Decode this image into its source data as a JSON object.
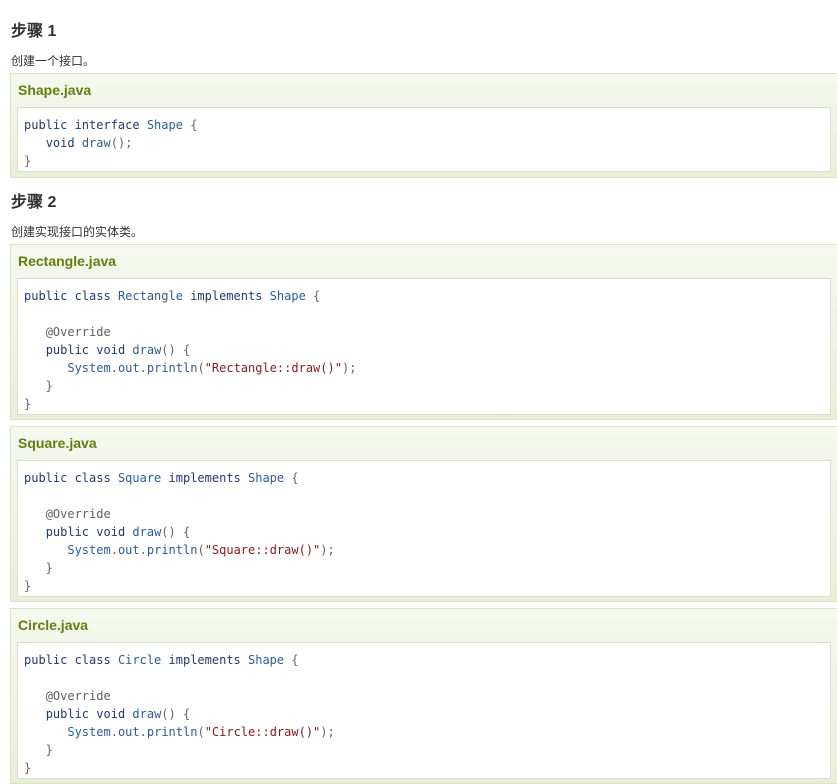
{
  "steps": [
    {
      "title": "步骤 1",
      "desc": "创建一个接口。",
      "examples": [
        {
          "filename": "Shape.java",
          "lines": [
            [
              {
                "t": "kw",
                "v": "public "
              },
              {
                "t": "kw",
                "v": "interface "
              },
              {
                "t": "tp",
                "v": "Shape "
              },
              {
                "t": "pn",
                "v": "{"
              }
            ],
            [
              {
                "t": "pn",
                "v": "   "
              },
              {
                "t": "kw",
                "v": "void "
              },
              {
                "t": "fn",
                "v": "draw"
              },
              {
                "t": "pn",
                "v": "();"
              }
            ],
            [
              {
                "t": "pn",
                "v": "}"
              }
            ]
          ]
        }
      ]
    },
    {
      "title": "步骤 2",
      "desc": "创建实现接口的实体类。",
      "examples": [
        {
          "filename": "Rectangle.java",
          "lines": [
            [
              {
                "t": "kw",
                "v": "public "
              },
              {
                "t": "kw",
                "v": "class "
              },
              {
                "t": "tp",
                "v": "Rectangle "
              },
              {
                "t": "kw",
                "v": "implements "
              },
              {
                "t": "tp",
                "v": "Shape "
              },
              {
                "t": "pn",
                "v": "{"
              }
            ],
            [],
            [
              {
                "t": "pn",
                "v": "   "
              },
              {
                "t": "an",
                "v": "@Override"
              }
            ],
            [
              {
                "t": "pn",
                "v": "   "
              },
              {
                "t": "kw",
                "v": "public "
              },
              {
                "t": "kw",
                "v": "void "
              },
              {
                "t": "fn",
                "v": "draw"
              },
              {
                "t": "pn",
                "v": "() {"
              }
            ],
            [
              {
                "t": "pn",
                "v": "      "
              },
              {
                "t": "fn",
                "v": "System"
              },
              {
                "t": "pn",
                "v": "."
              },
              {
                "t": "fn",
                "v": "out"
              },
              {
                "t": "pn",
                "v": "."
              },
              {
                "t": "fn",
                "v": "println"
              },
              {
                "t": "pn",
                "v": "("
              },
              {
                "t": "st",
                "v": "\"Rectangle::draw()\""
              },
              {
                "t": "pn",
                "v": ");"
              }
            ],
            [
              {
                "t": "pn",
                "v": "   }"
              }
            ],
            [
              {
                "t": "pn",
                "v": "}"
              }
            ]
          ]
        },
        {
          "filename": "Square.java",
          "lines": [
            [
              {
                "t": "kw",
                "v": "public "
              },
              {
                "t": "kw",
                "v": "class "
              },
              {
                "t": "tp",
                "v": "Square "
              },
              {
                "t": "kw",
                "v": "implements "
              },
              {
                "t": "tp",
                "v": "Shape "
              },
              {
                "t": "pn",
                "v": "{"
              }
            ],
            [],
            [
              {
                "t": "pn",
                "v": "   "
              },
              {
                "t": "an",
                "v": "@Override"
              }
            ],
            [
              {
                "t": "pn",
                "v": "   "
              },
              {
                "t": "kw",
                "v": "public "
              },
              {
                "t": "kw",
                "v": "void "
              },
              {
                "t": "fn",
                "v": "draw"
              },
              {
                "t": "pn",
                "v": "() {"
              }
            ],
            [
              {
                "t": "pn",
                "v": "      "
              },
              {
                "t": "fn",
                "v": "System"
              },
              {
                "t": "pn",
                "v": "."
              },
              {
                "t": "fn",
                "v": "out"
              },
              {
                "t": "pn",
                "v": "."
              },
              {
                "t": "fn",
                "v": "println"
              },
              {
                "t": "pn",
                "v": "("
              },
              {
                "t": "st",
                "v": "\"Square::draw()\""
              },
              {
                "t": "pn",
                "v": ");"
              }
            ],
            [
              {
                "t": "pn",
                "v": "   }"
              }
            ],
            [
              {
                "t": "pn",
                "v": "}"
              }
            ]
          ]
        },
        {
          "filename": "Circle.java",
          "lines": [
            [
              {
                "t": "kw",
                "v": "public "
              },
              {
                "t": "kw",
                "v": "class "
              },
              {
                "t": "tp",
                "v": "Circle "
              },
              {
                "t": "kw",
                "v": "implements "
              },
              {
                "t": "tp",
                "v": "Shape "
              },
              {
                "t": "pn",
                "v": "{"
              }
            ],
            [],
            [
              {
                "t": "pn",
                "v": "   "
              },
              {
                "t": "an",
                "v": "@Override"
              }
            ],
            [
              {
                "t": "pn",
                "v": "   "
              },
              {
                "t": "kw",
                "v": "public "
              },
              {
                "t": "kw",
                "v": "void "
              },
              {
                "t": "fn",
                "v": "draw"
              },
              {
                "t": "pn",
                "v": "() {"
              }
            ],
            [
              {
                "t": "pn",
                "v": "      "
              },
              {
                "t": "fn",
                "v": "System"
              },
              {
                "t": "pn",
                "v": "."
              },
              {
                "t": "fn",
                "v": "out"
              },
              {
                "t": "pn",
                "v": "."
              },
              {
                "t": "fn",
                "v": "println"
              },
              {
                "t": "pn",
                "v": "("
              },
              {
                "t": "st",
                "v": "\"Circle::draw()\""
              },
              {
                "t": "pn",
                "v": ");"
              }
            ],
            [
              {
                "t": "pn",
                "v": "   }"
              }
            ],
            [
              {
                "t": "pn",
                "v": "}"
              }
            ]
          ]
        }
      ]
    }
  ],
  "colors": {
    "example_title": "#617f10",
    "keyword": "#1f3a7a",
    "string": "#8b1a1a",
    "annotation": "#606060"
  }
}
